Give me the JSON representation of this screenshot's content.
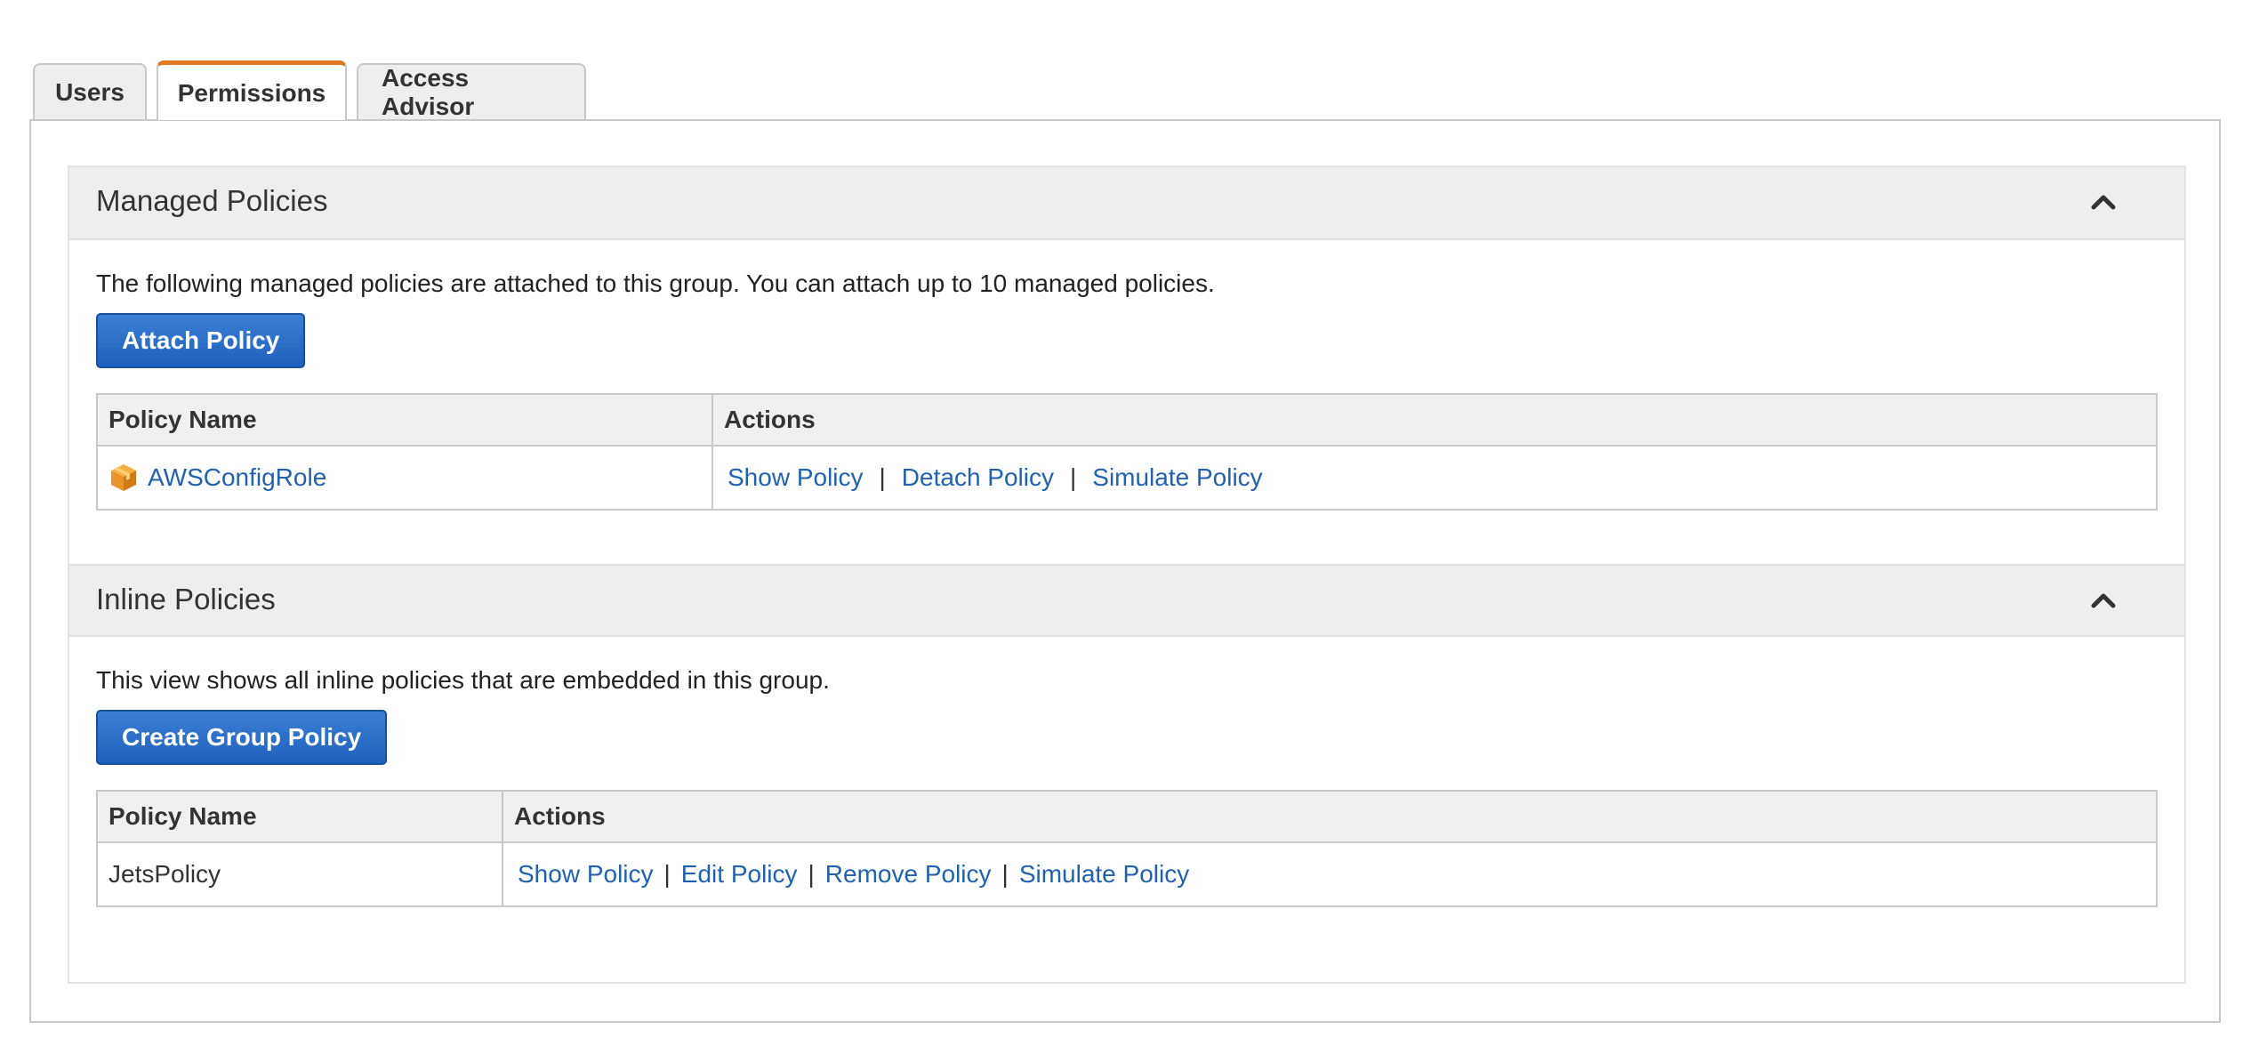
{
  "tabs": [
    {
      "label": "Users"
    },
    {
      "label": "Permissions"
    },
    {
      "label": "Access Advisor"
    }
  ],
  "active_tab": "Permissions",
  "accent_color": "#e07b24",
  "link_color": "#2162b0",
  "button_color": "#1e60bd",
  "managed": {
    "title": "Managed Policies",
    "description": "The following managed policies are attached to this group. You can attach up to 10 managed policies.",
    "button_label": "Attach Policy",
    "headers": {
      "name": "Policy Name",
      "actions": "Actions"
    },
    "rows": [
      {
        "icon": "policy-box-icon",
        "name": "AWSConfigRole",
        "actions": [
          "Show Policy",
          "Detach Policy",
          "Simulate Policy"
        ]
      }
    ]
  },
  "inline": {
    "title": "Inline Policies",
    "description": "This view shows all inline policies that are embedded in this group.",
    "button_label": "Create Group Policy",
    "headers": {
      "name": "Policy Name",
      "actions": "Actions"
    },
    "rows": [
      {
        "name": "JetsPolicy",
        "actions": [
          "Show Policy",
          "Edit Policy",
          "Remove Policy",
          "Simulate Policy"
        ]
      }
    ]
  },
  "separator": "|",
  "icons": {
    "collapse": "chevron-up-icon"
  }
}
